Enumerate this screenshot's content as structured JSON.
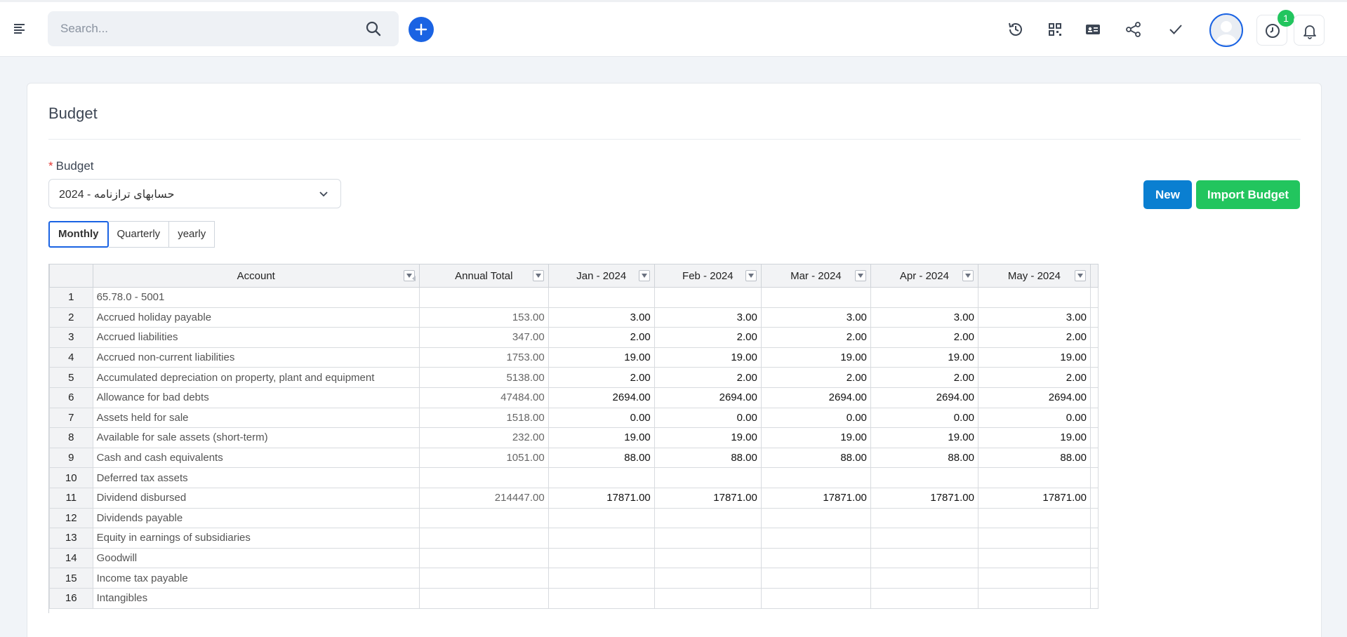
{
  "search": {
    "placeholder": "Search..."
  },
  "header": {
    "notification_count": "1"
  },
  "page": {
    "title": "Budget"
  },
  "form": {
    "budget_label": "Budget",
    "budget_value": "2024 - حسابهای ترازنامه",
    "new_label": "New",
    "import_label": "Import Budget"
  },
  "period_tabs": [
    {
      "label": "Monthly",
      "active": true
    },
    {
      "label": "Quarterly",
      "active": false
    },
    {
      "label": "yearly",
      "active": false
    }
  ],
  "grid": {
    "columns": [
      "Account",
      "Annual Total",
      "Jan - 2024",
      "Feb - 2024",
      "Mar - 2024",
      "Apr - 2024",
      "May - 2024"
    ],
    "rows": [
      {
        "n": "1",
        "account": "65.78.0 - 5001",
        "total": "",
        "months": [
          "",
          "",
          "",
          "",
          ""
        ]
      },
      {
        "n": "2",
        "account": "Accrued holiday payable",
        "total": "153.00",
        "months": [
          "3.00",
          "3.00",
          "3.00",
          "3.00",
          "3.00"
        ]
      },
      {
        "n": "3",
        "account": "Accrued liabilities",
        "total": "347.00",
        "months": [
          "2.00",
          "2.00",
          "2.00",
          "2.00",
          "2.00"
        ]
      },
      {
        "n": "4",
        "account": "Accrued non-current liabilities",
        "total": "1753.00",
        "months": [
          "19.00",
          "19.00",
          "19.00",
          "19.00",
          "19.00"
        ]
      },
      {
        "n": "5",
        "account": "Accumulated depreciation on property, plant and equipment",
        "total": "5138.00",
        "months": [
          "2.00",
          "2.00",
          "2.00",
          "2.00",
          "2.00"
        ]
      },
      {
        "n": "6",
        "account": "Allowance for bad debts",
        "total": "47484.00",
        "months": [
          "2694.00",
          "2694.00",
          "2694.00",
          "2694.00",
          "2694.00"
        ]
      },
      {
        "n": "7",
        "account": "Assets held for sale",
        "total": "1518.00",
        "months": [
          "0.00",
          "0.00",
          "0.00",
          "0.00",
          "0.00"
        ]
      },
      {
        "n": "8",
        "account": "Available for sale assets (short-term)",
        "total": "232.00",
        "months": [
          "19.00",
          "19.00",
          "19.00",
          "19.00",
          "19.00"
        ]
      },
      {
        "n": "9",
        "account": "Cash and cash equivalents",
        "total": "1051.00",
        "months": [
          "88.00",
          "88.00",
          "88.00",
          "88.00",
          "88.00"
        ]
      },
      {
        "n": "10",
        "account": "Deferred tax assets",
        "total": "",
        "months": [
          "",
          "",
          "",
          "",
          ""
        ]
      },
      {
        "n": "11",
        "account": "Dividend disbursed",
        "total": "214447.00",
        "months": [
          "17871.00",
          "17871.00",
          "17871.00",
          "17871.00",
          "17871.00"
        ]
      },
      {
        "n": "12",
        "account": "Dividends payable",
        "total": "",
        "months": [
          "",
          "",
          "",
          "",
          ""
        ]
      },
      {
        "n": "13",
        "account": "Equity in earnings of subsidiaries",
        "total": "",
        "months": [
          "",
          "",
          "",
          "",
          ""
        ]
      },
      {
        "n": "14",
        "account": "Goodwill",
        "total": "",
        "months": [
          "",
          "",
          "",
          "",
          ""
        ]
      },
      {
        "n": "15",
        "account": "Income tax payable",
        "total": "",
        "months": [
          "",
          "",
          "",
          "",
          ""
        ]
      },
      {
        "n": "16",
        "account": "Intangibles",
        "total": "",
        "months": [
          "",
          "",
          "",
          "",
          ""
        ]
      }
    ]
  }
}
